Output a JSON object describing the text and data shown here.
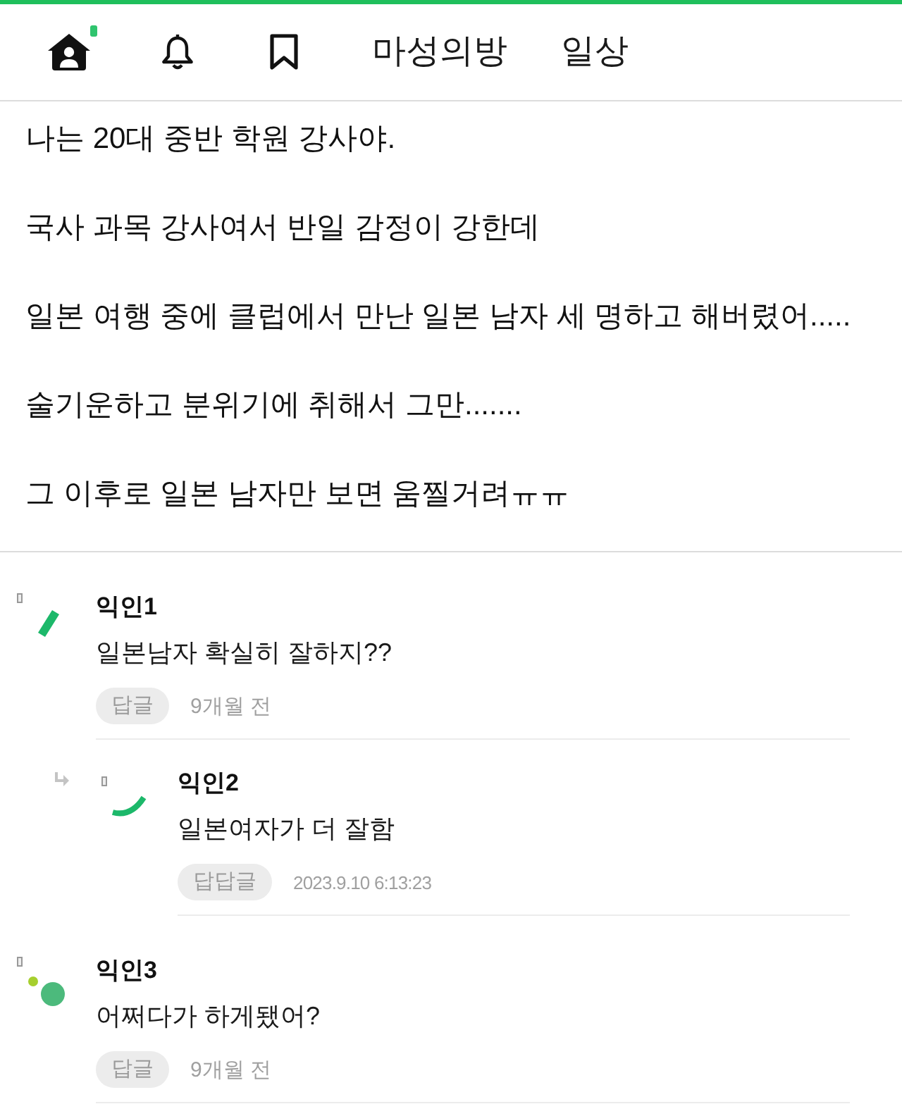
{
  "nav_icons": [
    {
      "kind": "home",
      "badge": true
    },
    {
      "kind": "bell",
      "badge": false
    },
    {
      "kind": "bookmark",
      "badge": false
    }
  ],
  "tabs": [
    {
      "label": "마성의방"
    },
    {
      "label": "일상"
    }
  ],
  "post": {
    "paragraphs": [
      "나는 20대 중반 학원 강사야.",
      "국사 과목 강사여서 반일 감정이 강한데",
      "일본 여행 중에 클럽에서 만난 일본 남자 세 명하고 해버렸어.....",
      "술기운하고 분위기에 취해서 그만.......",
      "그 이후로 일본 남자만 보면 움찔거려ㅠㅠ"
    ]
  },
  "comments": [
    {
      "author": "익인1",
      "avatar": {
        "kind": "dash"
      },
      "text": "일본남자 확실히 잘하지??",
      "reply_button": "답글",
      "time": "9개월 전",
      "children": [
        {
          "author": "익인2",
          "avatar": {
            "kind": "arc"
          },
          "text": "일본여자가 더 잘함",
          "reply_button": "답답글",
          "time": "2023.9.10 6:13:23"
        }
      ]
    },
    {
      "author": "익인3",
      "avatar": {
        "kind": "dots"
      },
      "text": "어쩌다가 하게됐어?",
      "reply_button": "답글",
      "time": "9개월 전"
    }
  ]
}
